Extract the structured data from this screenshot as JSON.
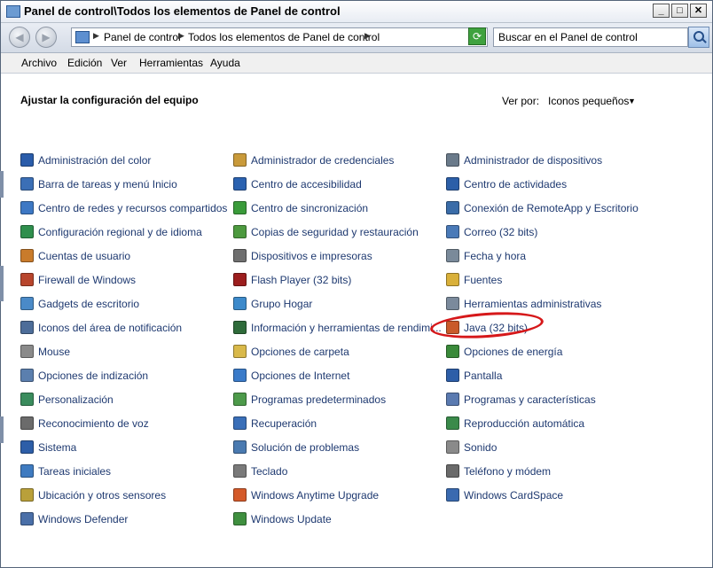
{
  "title": "Panel de control\\Todos los elementos de Panel de control",
  "address": {
    "segments": [
      "Panel de control",
      "Todos los elementos de Panel de control"
    ]
  },
  "search": {
    "placeholder": "Buscar en el Panel de control"
  },
  "menu": [
    "Archivo",
    "Edición",
    "Ver",
    "Herramientas",
    "Ayuda"
  ],
  "heading": "Ajustar la configuración del equipo",
  "viewby": {
    "label": "Ver por:",
    "value": "Iconos pequeños"
  },
  "columns": [
    [
      {
        "label": "Administración del color",
        "icon": "monitor-icon",
        "color": "#2a5caa"
      },
      {
        "label": "Barra de tareas y menú Inicio",
        "icon": "taskbar-icon",
        "color": "#3b6fb6"
      },
      {
        "label": "Centro de redes y recursos compartidos",
        "icon": "network-icon",
        "color": "#3d78c4"
      },
      {
        "label": "Configuración regional y de idioma",
        "icon": "globe-icon",
        "color": "#2f8f4d"
      },
      {
        "label": "Cuentas de usuario",
        "icon": "users-icon",
        "color": "#c97b2b"
      },
      {
        "label": "Firewall de Windows",
        "icon": "firewall-icon",
        "color": "#b8452c"
      },
      {
        "label": "Gadgets de escritorio",
        "icon": "gadgets-icon",
        "color": "#4a8ac8"
      },
      {
        "label": "Iconos del área de notificación",
        "icon": "notification-icon",
        "color": "#4d6d99"
      },
      {
        "label": "Mouse",
        "icon": "mouse-icon",
        "color": "#8a8a8a"
      },
      {
        "label": "Opciones de indización",
        "icon": "search-icon",
        "color": "#5b7fae"
      },
      {
        "label": "Personalización",
        "icon": "personalization-icon",
        "color": "#3a8c5d"
      },
      {
        "label": "Reconocimiento de voz",
        "icon": "microphone-icon",
        "color": "#6b6b6b"
      },
      {
        "label": "Sistema",
        "icon": "system-icon",
        "color": "#2d5ea8"
      },
      {
        "label": "Tareas iniciales",
        "icon": "start-tasks-icon",
        "color": "#3f7bc0"
      },
      {
        "label": "Ubicación y otros sensores",
        "icon": "sensor-icon",
        "color": "#b9a03a"
      },
      {
        "label": "Windows Defender",
        "icon": "defender-icon",
        "color": "#4a6fa8"
      }
    ],
    [
      {
        "label": "Administrador de credenciales",
        "icon": "credentials-icon",
        "color": "#c99a3a"
      },
      {
        "label": "Centro de accesibilidad",
        "icon": "accessibility-icon",
        "color": "#2b62b0"
      },
      {
        "label": "Centro de sincronización",
        "icon": "sync-icon",
        "color": "#3a9b3a"
      },
      {
        "label": "Copias de seguridad y restauración",
        "icon": "backup-icon",
        "color": "#4d9a3f"
      },
      {
        "label": "Dispositivos e impresoras",
        "icon": "printer-icon",
        "color": "#6f6f6f"
      },
      {
        "label": "Flash Player (32 bits)",
        "icon": "flash-icon",
        "color": "#9c1e1e"
      },
      {
        "label": "Grupo Hogar",
        "icon": "homegroup-icon",
        "color": "#3d8acb"
      },
      {
        "label": "Información y herramientas de rendimi...",
        "icon": "performance-icon",
        "color": "#2f6b3a"
      },
      {
        "label": "Opciones de carpeta",
        "icon": "folder-icon",
        "color": "#d9b94a"
      },
      {
        "label": "Opciones de Internet",
        "icon": "internet-icon",
        "color": "#3a7bc9"
      },
      {
        "label": "Programas predeterminados",
        "icon": "default-programs-icon",
        "color": "#4d9a4a"
      },
      {
        "label": "Recuperación",
        "icon": "recovery-icon",
        "color": "#3a6fb8"
      },
      {
        "label": "Solución de problemas",
        "icon": "troubleshoot-icon",
        "color": "#4a7ab0"
      },
      {
        "label": "Teclado",
        "icon": "keyboard-icon",
        "color": "#7a7a7a"
      },
      {
        "label": "Windows Anytime Upgrade",
        "icon": "windows-icon",
        "color": "#d45a2a"
      },
      {
        "label": "Windows Update",
        "icon": "update-icon",
        "color": "#3f8f3f"
      }
    ],
    [
      {
        "label": "Administrador de dispositivos",
        "icon": "device-manager-icon",
        "color": "#6a7a8a"
      },
      {
        "label": "Centro de actividades",
        "icon": "flag-icon",
        "color": "#2c5fa8"
      },
      {
        "label": "Conexión de RemoteApp y Escritorio",
        "icon": "remote-icon",
        "color": "#3a6ca8"
      },
      {
        "label": "Correo (32 bits)",
        "icon": "mail-icon",
        "color": "#4a7ab8"
      },
      {
        "label": "Fecha y hora",
        "icon": "clock-icon",
        "color": "#7a8a9a"
      },
      {
        "label": "Fuentes",
        "icon": "fonts-icon",
        "color": "#d9b03a"
      },
      {
        "label": "Herramientas administrativas",
        "icon": "admin-tools-icon",
        "color": "#7b8a9c"
      },
      {
        "label": "Java (32 bits)",
        "icon": "java-icon",
        "color": "#c95a2a"
      },
      {
        "label": "Opciones de energía",
        "icon": "power-icon",
        "color": "#3a8a3a"
      },
      {
        "label": "Pantalla",
        "icon": "display-icon",
        "color": "#2d5ea8"
      },
      {
        "label": "Programas y características",
        "icon": "programs-icon",
        "color": "#5a7ab0"
      },
      {
        "label": "Reproducción automática",
        "icon": "autoplay-icon",
        "color": "#3a8a4a"
      },
      {
        "label": "Sonido",
        "icon": "speaker-icon",
        "color": "#8a8a8a"
      },
      {
        "label": "Teléfono y módem",
        "icon": "phone-icon",
        "color": "#6a6a6a"
      },
      {
        "label": "Windows CardSpace",
        "icon": "cardspace-icon",
        "color": "#3a6ab0"
      }
    ]
  ]
}
